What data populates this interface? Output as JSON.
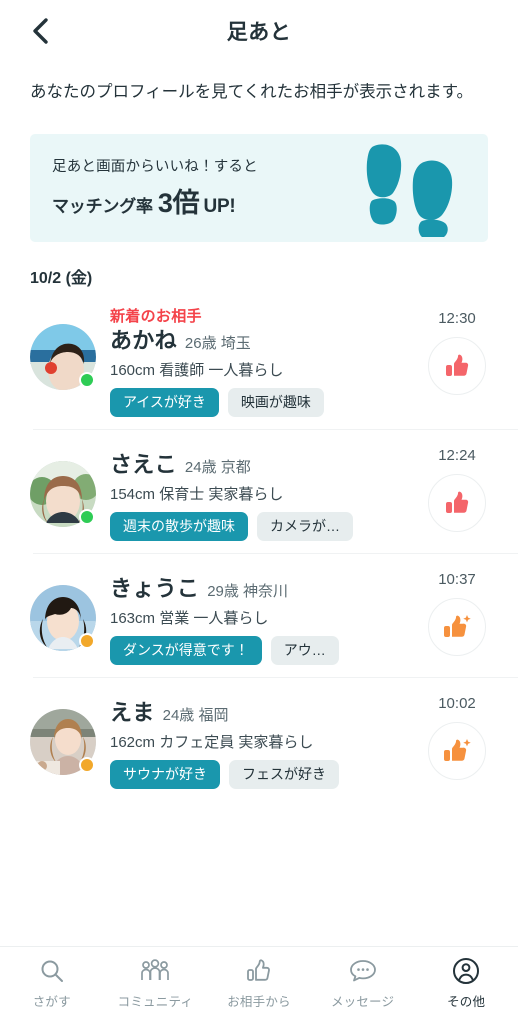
{
  "header": {
    "back_icon": "chevron-left-icon",
    "title": "足あと"
  },
  "description": "あなたのプロフィールを見てくれたお相手が表示されます。",
  "banner": {
    "line1": "足あと画面からいいね！すると",
    "line2_small": "マッチング率",
    "line2_big": "3倍",
    "line2_up": "UP!",
    "icon": "footprints-icon",
    "bg_color": "#eaf7f8",
    "icon_color": "#1a97ad"
  },
  "date_label": "10/2 (金)",
  "visitors": [
    {
      "badge": "新着のお相手",
      "name": "あかね",
      "age_area": "26歳 埼玉",
      "meta": "160cm 看護師 一人暮らし",
      "tags": [
        "アイスが好き",
        "映画が趣味"
      ],
      "time": "12:30",
      "status": "online",
      "status_color": "#2ecc55",
      "like_icon": "thumbs-up-icon",
      "like_color": "#f4656a",
      "avatar": "photo-beach-flower"
    },
    {
      "badge": "",
      "name": "さえこ",
      "age_area": "24歳 京都",
      "meta": "154cm 保育士 実家暮らし",
      "tags": [
        "週末の散歩が趣味",
        "カメラが…"
      ],
      "time": "12:24",
      "status": "online",
      "status_color": "#2ecc55",
      "like_icon": "thumbs-up-icon",
      "like_color": "#f4656a",
      "avatar": "photo-park-portrait"
    },
    {
      "badge": "",
      "name": "きょうこ",
      "age_area": "29歳 神奈川",
      "meta": "163cm 営業 一人暮らし",
      "tags": [
        "ダンスが得意です！",
        "アウ…"
      ],
      "time": "10:37",
      "status": "away",
      "status_color": "#f2a82a",
      "like_icon": "thumbs-up-sparkle-icon",
      "like_color": "#f6913e",
      "avatar": "photo-blue-portrait"
    },
    {
      "badge": "",
      "name": "えま",
      "age_area": "24歳 福岡",
      "meta": "162cm カフェ定員 実家暮らし",
      "tags": [
        "サウナが好き",
        "フェスが好き"
      ],
      "time": "10:02",
      "status": "away",
      "status_color": "#f2a82a",
      "like_icon": "thumbs-up-sparkle-icon",
      "like_color": "#f6913e",
      "avatar": "photo-cafe-table"
    }
  ],
  "bottom_nav": {
    "items": [
      {
        "label": "さがす",
        "icon": "search-icon"
      },
      {
        "label": "コミュニティ",
        "icon": "people-group-icon"
      },
      {
        "label": "お相手から",
        "icon": "thumbs-up-outline-icon"
      },
      {
        "label": "メッセージ",
        "icon": "chat-bubble-icon"
      },
      {
        "label": "その他",
        "icon": "account-circle-icon"
      }
    ],
    "active_index": 4,
    "active_color": "#24333a",
    "inactive_color": "#8b9aa0"
  }
}
